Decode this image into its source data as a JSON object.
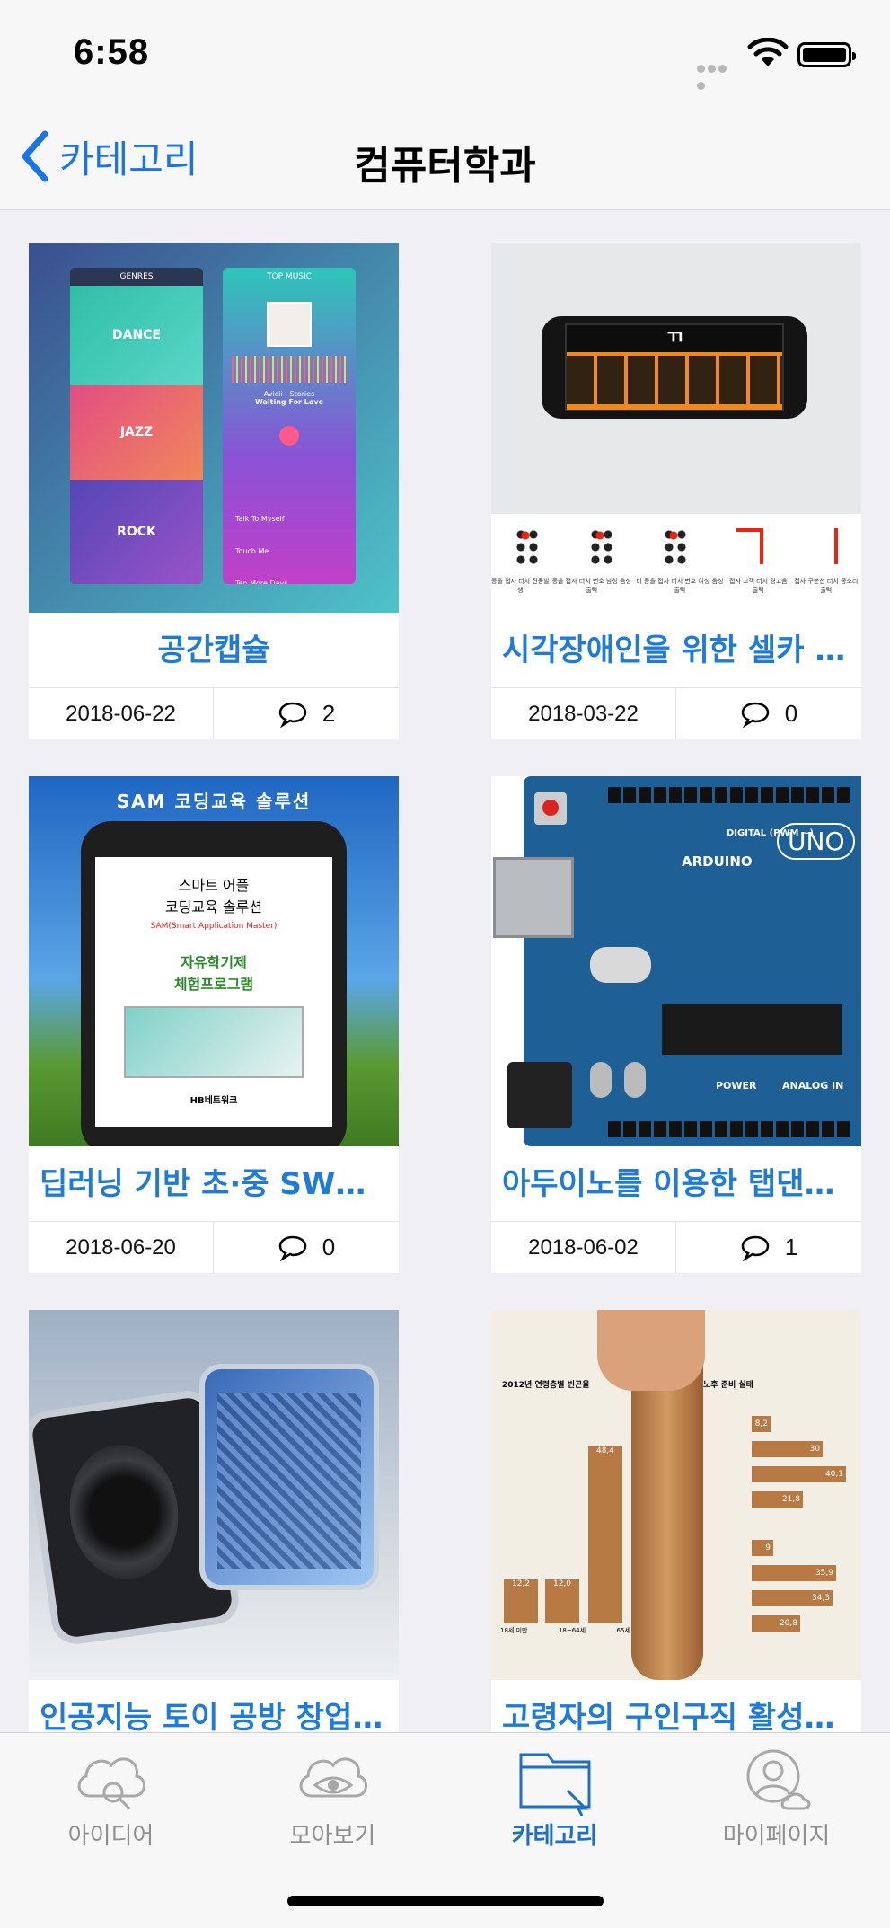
{
  "status_bar": {
    "time": "6:58"
  },
  "nav": {
    "back_label": "카테고리",
    "title": "컴퓨터학과"
  },
  "cards": [
    {
      "title": "공간캡슐",
      "date": "2018-06-22",
      "comments": "2"
    },
    {
      "title": "시각장애인을 위한 셀카 가…",
      "date": "2018-03-22",
      "comments": "0"
    },
    {
      "title": "딥러닝 기반 초·중 SW코딩…",
      "date": "2018-06-20",
      "comments": "0"
    },
    {
      "title": "아두이노를 이용한 탭댄스…",
      "date": "2018-06-02",
      "comments": "1"
    },
    {
      "title": "인공지능 토이 공방 창업 인…",
      "date": "",
      "comments": ""
    },
    {
      "title": "고령자의 구인구직 활성화…",
      "date": "",
      "comments": ""
    }
  ],
  "thumb_text": {
    "music": {
      "genres": "GENRES",
      "top_music": "TOP MUSIC",
      "dance": "DANCE",
      "jazz": "JAZZ",
      "rock": "ROCK",
      "track1": "Talk To Myself",
      "track2": "Touch Me",
      "track3": "Ten More Days",
      "artist": "Avicii - Stories",
      "song": "Waiting For Love"
    },
    "braille": {
      "screen_char": "ㄲ",
      "captions": [
        "등을 접자 터치 \n 진동발생",
        "등을 접자 터치 \n 번호 남성 음성 출력",
        "비 등을 접자 터치 \n 번호 여성 음성 출력",
        "접자 고객 터치 \n 경고음 출력",
        "접자 구분선 터치 \n 종소리 출력"
      ]
    },
    "sam": {
      "banner": "SAM 코딩교육 솔루션",
      "line1": "스마트 어플",
      "line2": "코딩교육 솔루션",
      "line3": "SAM(Smart Application Master)",
      "line4": "자유학기제",
      "line5": "체험프로그램",
      "footer": "HB네트워크"
    },
    "arduino": {
      "brand": "ARDUINO",
      "model": "UNO",
      "digital": "DIGITAL (PWM ~)",
      "power": "POWER",
      "analog": "ANALOG IN"
    },
    "chart": {
      "left_title": "2012년 연령층별 빈곤율",
      "right_title": "노후 준비 실태",
      "left_values": [
        "12,2",
        "12,0",
        "48,4"
      ],
      "left_labels": [
        "18세 미만",
        "18~64세",
        "65세 이상"
      ],
      "right_values": [
        "8,2",
        "30",
        "40,1",
        "21,8",
        "9",
        "35,9",
        "34,3",
        "20,8"
      ]
    }
  },
  "tabs": [
    {
      "label": "아이디어",
      "icon": "idea-icon"
    },
    {
      "label": "모아보기",
      "icon": "browse-icon"
    },
    {
      "label": "카테고리",
      "icon": "category-icon"
    },
    {
      "label": "마이페이지",
      "icon": "mypage-icon"
    }
  ],
  "colors": {
    "accent": "#1f7bd8",
    "tab_active": "#1f6fc8",
    "tab_inactive": "#8f8f8f"
  }
}
